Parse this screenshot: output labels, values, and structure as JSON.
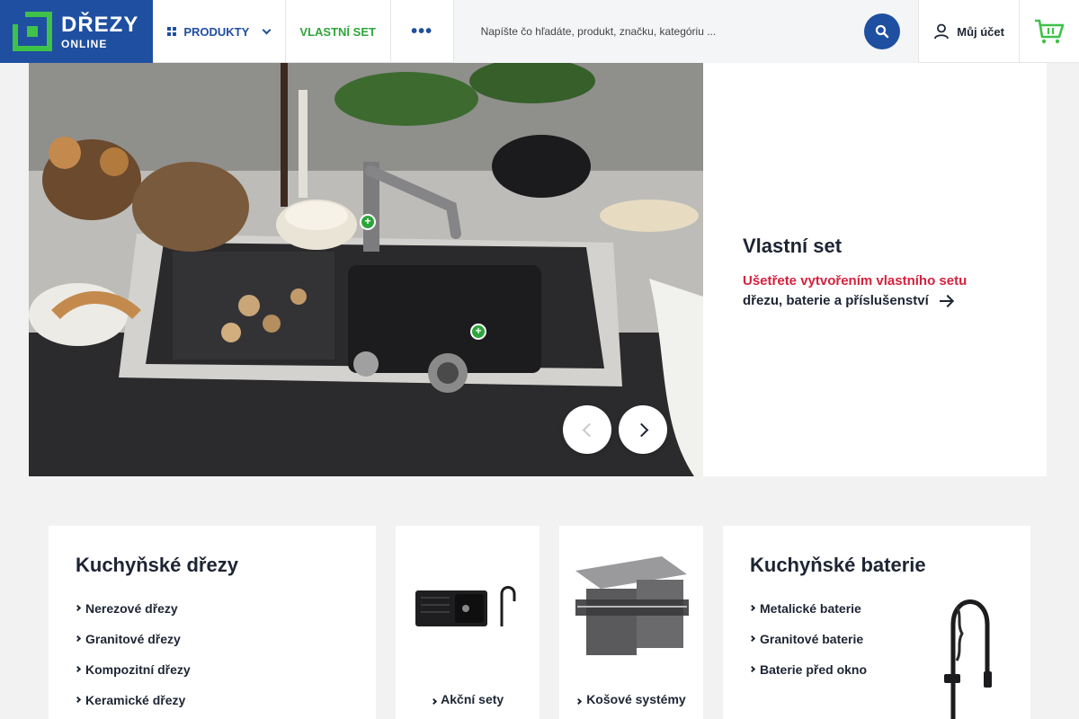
{
  "header": {
    "logo_line1": "DŘEZY",
    "logo_line2": "ONLINE",
    "nav_products": "PRODUKTY",
    "nav_custom_set": "VLASTNÍ SET",
    "nav_more": "•••",
    "search_placeholder": "Napíšte čo hľadáte, produkt, značku, kategóriu ...",
    "account_label": "Můj účet"
  },
  "hero": {
    "title": "Vlastní set",
    "promo": "Ušetřete vytvořením vlastního setu",
    "subtitle": "dřezu, baterie a příslušenství"
  },
  "categories": {
    "sinks": {
      "title": "Kuchyňské dřezy",
      "items": [
        "Nerezové dřezy",
        "Granitové dřezy",
        "Kompozitní dřezy",
        "Keramické dřezy"
      ]
    },
    "sets": {
      "label": "Akční sety"
    },
    "baskets": {
      "label": "Košové systémy"
    },
    "taps": {
      "title": "Kuchyňské baterie",
      "items": [
        "Metalické baterie",
        "Granitové baterie",
        "Baterie před okno"
      ]
    }
  },
  "colors": {
    "brand_blue": "#1f4fa0",
    "brand_green": "#3fc24a",
    "accent_red": "#d4213d"
  }
}
